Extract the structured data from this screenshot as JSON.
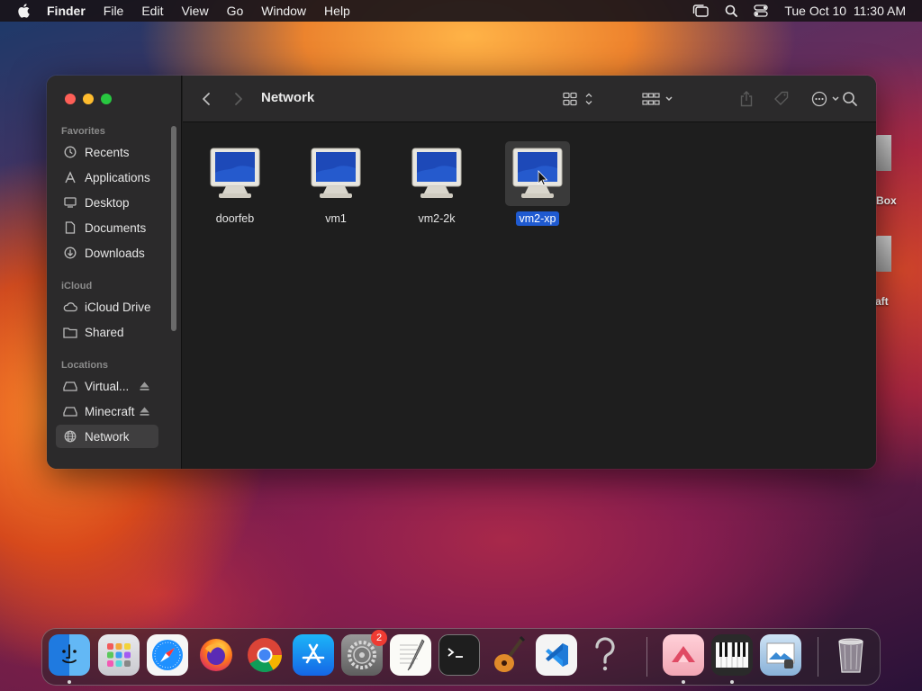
{
  "menubar": {
    "app": "Finder",
    "items": [
      "File",
      "Edit",
      "View",
      "Go",
      "Window",
      "Help"
    ],
    "datetime": "Tue Oct 10  11:30 AM"
  },
  "desktop": {
    "icons": [
      {
        "label": "Box"
      },
      {
        "label": "aft"
      }
    ]
  },
  "window": {
    "title": "Network",
    "sidebar": {
      "favorites_header": "Favorites",
      "favorites": [
        {
          "label": "Recents",
          "icon": "clock-icon"
        },
        {
          "label": "Applications",
          "icon": "applications-icon"
        },
        {
          "label": "Desktop",
          "icon": "desktop-icon"
        },
        {
          "label": "Documents",
          "icon": "document-icon"
        },
        {
          "label": "Downloads",
          "icon": "download-icon"
        }
      ],
      "icloud_header": "iCloud",
      "icloud": [
        {
          "label": "iCloud Drive",
          "icon": "cloud-icon"
        },
        {
          "label": "Shared",
          "icon": "shared-folder-icon"
        }
      ],
      "locations_header": "Locations",
      "locations": [
        {
          "label": "Virtual...",
          "icon": "drive-icon",
          "eject": true
        },
        {
          "label": "Minecraft",
          "icon": "drive-icon",
          "eject": true
        },
        {
          "label": "Network",
          "icon": "globe-icon",
          "selected": true
        }
      ]
    },
    "files": [
      {
        "label": "doorfeb",
        "icon": "computer-monitor-icon"
      },
      {
        "label": "vm1",
        "icon": "computer-monitor-icon"
      },
      {
        "label": "vm2-2k",
        "icon": "computer-monitor-icon"
      },
      {
        "label": "vm2-xp",
        "icon": "computer-monitor-icon",
        "selected": true
      }
    ]
  },
  "dock": {
    "apps": [
      "Finder",
      "Launchpad",
      "Safari",
      "Firefox",
      "Chrome",
      "App Store",
      "System Settings",
      "TextEdit",
      "Terminal",
      "GarageBand",
      "Visual Studio Code",
      "Help",
      "Affinity",
      "Piano",
      "Preview",
      "Trash"
    ],
    "settings_badge": "2"
  },
  "colors": {
    "selection": "#1f5ad0",
    "close": "#fe5f57",
    "minimize": "#febc2e",
    "zoom": "#28c840"
  }
}
